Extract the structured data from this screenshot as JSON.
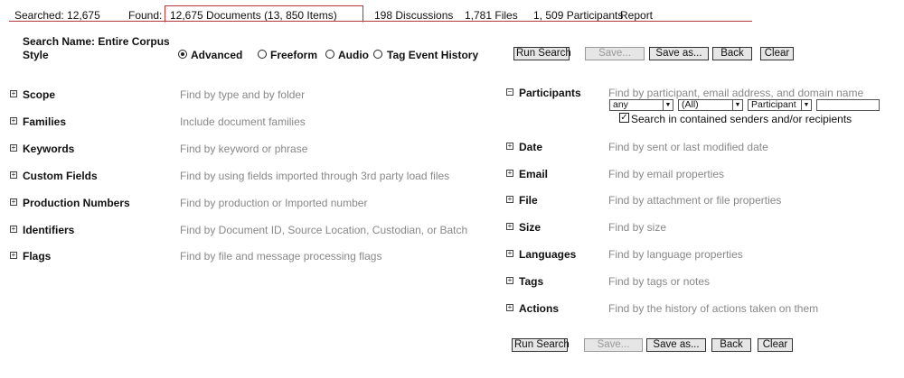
{
  "tabs": {
    "searched": "Searched: 12,675",
    "found_label": "Found:",
    "found_value": "12,675 Documents (13, 850 Items)",
    "discussions": "198 Discussions",
    "files": "1,781 Files",
    "participants": "1, 509 Participants",
    "report": "Report"
  },
  "header": {
    "search_name": "Search Name: Entire Corpus",
    "style_label": "Style",
    "radio_options": [
      {
        "label": "Advanced",
        "selected": true
      },
      {
        "label": "Freeform",
        "selected": false
      },
      {
        "label": "Audio",
        "selected": false
      },
      {
        "label": "Tag Event History",
        "selected": false
      }
    ]
  },
  "toolbar": {
    "run": "Run Search",
    "save": "Save...",
    "save_as": "Save as...",
    "back": "Back",
    "clear": "Clear"
  },
  "left_sections": [
    {
      "label": "Scope",
      "desc": "Find by type and by folder"
    },
    {
      "label": "Families",
      "desc": "Include document families"
    },
    {
      "label": "Keywords",
      "desc": "Find by keyword or phrase"
    },
    {
      "label": "Custom Fields",
      "desc": "Find by using fields imported through 3rd party load files"
    },
    {
      "label": "Production Numbers",
      "desc": "Find by production or Imported number"
    },
    {
      "label": "Identifiers",
      "desc": "Find by Document ID, Source Location, Custodian, or Batch"
    },
    {
      "label": "Flags",
      "desc": "Find by file and message processing flags"
    }
  ],
  "participants": {
    "label": "Participants",
    "desc": "Find by participant, email address, and domain name",
    "select1": "any",
    "select2": "(All)",
    "select3": "Participant",
    "input_value": "",
    "checkbox_label": "Search in contained senders and/or recipients",
    "checkbox_checked": true
  },
  "right_sections": [
    {
      "label": "Date",
      "desc": "Find by sent or last modified date"
    },
    {
      "label": "Email",
      "desc": "Find by email properties"
    },
    {
      "label": "File",
      "desc": "Find by attachment or file properties"
    },
    {
      "label": "Size",
      "desc": "Find by size"
    },
    {
      "label": "Languages",
      "desc": "Find by language properties"
    },
    {
      "label": "Tags",
      "desc": "Find by tags or notes"
    },
    {
      "label": "Actions",
      "desc": "Find by the history of actions taken on them"
    }
  ],
  "icons": {
    "expand": "plus-box-icon",
    "collapse": "minus-box-icon",
    "checkbox": "checkmark-icon"
  }
}
